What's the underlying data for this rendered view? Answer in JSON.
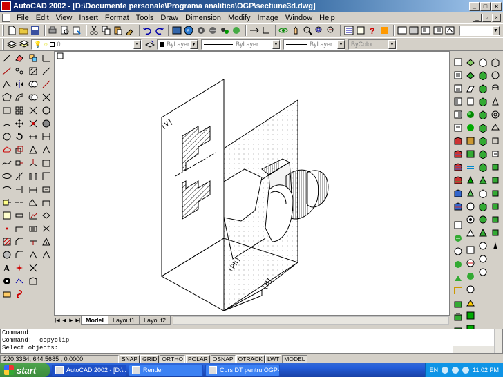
{
  "window": {
    "title": "AutoCAD 2002 - [D:\\Documente personale\\Programa analitica\\OGP\\sectiune3d.dwg]",
    "buttons": [
      "_",
      "□",
      "×"
    ]
  },
  "menu": {
    "items": [
      "File",
      "Edit",
      "View",
      "Insert",
      "Format",
      "Tools",
      "Draw",
      "Dimension",
      "Modify",
      "Image",
      "Window",
      "Help"
    ]
  },
  "properties": {
    "layer_value": "0",
    "color_value": "ByLayer",
    "linetype_value": "ByLayer",
    "lineweight_value": "ByLayer",
    "plotstyle_value": "ByColor"
  },
  "drawing": {
    "plane_v_label": "[V]",
    "plane_ph_label": "(Ph)",
    "plane_h_label": "[H]"
  },
  "tabs": {
    "items": [
      "Model",
      "Layout1",
      "Layout2"
    ],
    "active": "Model"
  },
  "command": {
    "lines": [
      "Command:",
      "Command: _copyclip",
      "Select objects:"
    ]
  },
  "status": {
    "coordinates": "220.3364, 644.5685 , 0.0000",
    "toggles": [
      {
        "label": "SNAP",
        "on": false
      },
      {
        "label": "GRID",
        "on": false
      },
      {
        "label": "ORTHO",
        "on": true
      },
      {
        "label": "POLAR",
        "on": false
      },
      {
        "label": "OSNAP",
        "on": true
      },
      {
        "label": "OTRACK",
        "on": false
      },
      {
        "label": "LWT",
        "on": false
      },
      {
        "label": "MODEL",
        "on": true
      }
    ]
  },
  "taskbar": {
    "start_label": "start",
    "tasks": [
      {
        "label": "AutoCAD 2002 - [D:\\...",
        "active": true
      },
      {
        "label": "Render",
        "active": false
      },
      {
        "label": "Curs DT pentru OGP-...",
        "active": false
      }
    ],
    "language": "EN",
    "clock": "11:02 PM"
  },
  "colors": {
    "title_start": "#0a246a",
    "taskbar": "#245edb",
    "start_green": "#3c8c3c"
  }
}
